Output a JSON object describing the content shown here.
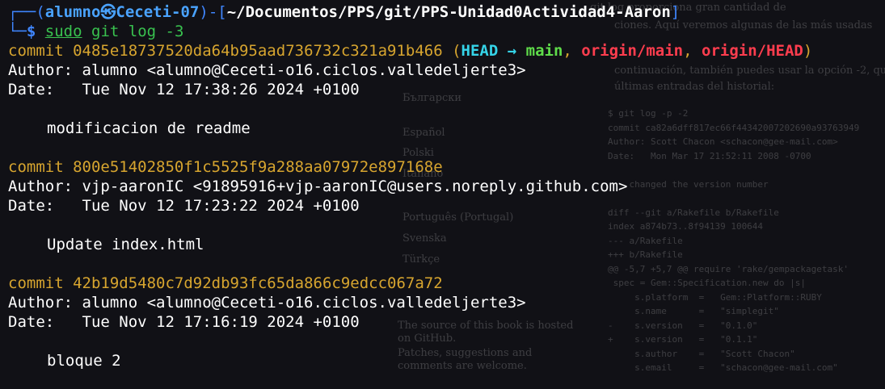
{
  "prompt": {
    "open": "┌──(",
    "user": "alumno",
    "skull": "㉿",
    "host": "Ceceti-07",
    "sep": ")-[",
    "path": "~/Documentos/PPS/git/PPS-Unidad0Actividad4-Aaron",
    "close": "]",
    "line2_prefix": "└─",
    "dollar": "$",
    "sudo": "sudo",
    "command": " git log -3"
  },
  "commits": [
    {
      "label": "commit",
      "hash": "0485e18737520da64b95aad736732c321a91b466",
      "refs": {
        "open": " (",
        "head": "HEAD",
        "arrow": " → ",
        "branch": "main",
        "comma1": ", ",
        "remote1": "origin/main",
        "comma2": ", ",
        "remote2": "origin/HEAD",
        "close": ")"
      },
      "author_line": "Author: alumno <alumno@Ceceti-o16.ciclos.valledeljerte3>",
      "date_line": "Date:   Tue Nov 12 17:38:26 2024 +0100",
      "message": "modificacion de readme"
    },
    {
      "label": "commit",
      "hash": "800e51402850f1c5525f9a288aa07972e897168e",
      "author_line": "Author: vjp-aaronIC <91895916+vjp-aaronIC@users.noreply.github.com>",
      "date_line": "Date:   Tue Nov 12 17:23:22 2024 +0100",
      "message": "Update index.html"
    },
    {
      "label": "commit",
      "hash": "42b19d5480c7d92db93fc65da866c9edcc067a72",
      "author_line": "Author: alumno <alumno@Ceceti-o16.ciclos.valledeljerte3>",
      "date_line": "Date:   Tue Nov 12 17:16:19 2024 +0100",
      "message": "bloque 2"
    }
  ],
  "background_page": {
    "lines": [
      "git log   proporciona gran cantidad de",
      "ciones. Aquí veremos algunas de las más usadas",
      "continuación, también puedes usar la opción -2, qu",
      "últimas entradas del historial:"
    ],
    "sidebar": [
      "Български",
      "Español",
      "Polski",
      "Italiano",
      "Português (Portugal)",
      "Svenska",
      "Türkçe",
      "The source of this book is hosted",
      "on GitHub.",
      "Patches, suggestions and",
      "comments are welcome."
    ],
    "code": [
      "$ git log -p -2",
      "commit ca82a6dff817ec66f44342007202690a93763949",
      "Author: Scott Chacon <schacon@gee-mail.com>",
      "Date:   Mon Mar 17 21:52:11 2008 -0700",
      "",
      "    changed the version number",
      "",
      "diff --git a/Rakefile b/Rakefile",
      "index a874b73..8f94139 100644",
      "--- a/Rakefile",
      "+++ b/Rakefile",
      "@@ -5,7 +5,7 @@ require 'rake/gempackagetask'",
      " spec = Gem::Specification.new do |s|",
      "     s.platform  =   Gem::Platform::RUBY",
      "     s.name      =   \"simplegit\"",
      "-    s.version   =   \"0.1.0\"",
      "+    s.version   =   \"0.1.1\"",
      "     s.author    =   \"Scott Chacon\"",
      "     s.email     =   \"schacon@gee-mail.com\""
    ]
  }
}
